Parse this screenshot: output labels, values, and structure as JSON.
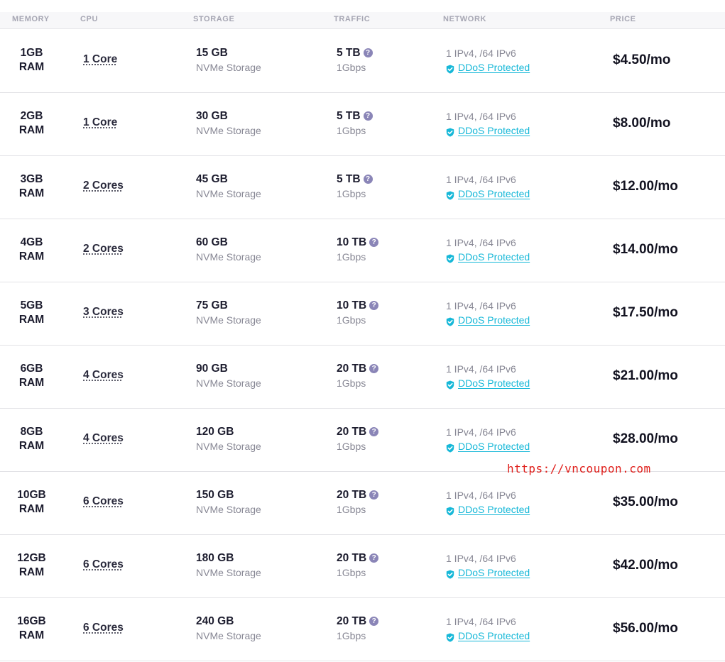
{
  "header": {
    "memory": "MEMORY",
    "cpu": "CPU",
    "storage": "STORAGE",
    "traffic": "TRAFFIC",
    "network": "NETWORK",
    "price": "PRICE"
  },
  "colors": {
    "accent_link": "#17b8d8",
    "help_icon": "#8a85b7",
    "watermark": "#e0201c"
  },
  "icons": {
    "help": "question-circle-icon",
    "ddos": "shield-check-icon"
  },
  "plans": [
    {
      "ram": "1GB",
      "ram_unit": "RAM",
      "cpu": "1 Core",
      "storage": "15 GB",
      "storage_type": "NVMe Storage",
      "traffic": "5 TB",
      "port": "1Gbps",
      "ips": "1 IPv4, /64 IPv6",
      "ddos": "DDoS Protected",
      "price": "$4.50/mo"
    },
    {
      "ram": "2GB",
      "ram_unit": "RAM",
      "cpu": "1 Core",
      "storage": "30 GB",
      "storage_type": "NVMe Storage",
      "traffic": "5 TB",
      "port": "1Gbps",
      "ips": "1 IPv4, /64 IPv6",
      "ddos": "DDoS Protected",
      "price": "$8.00/mo"
    },
    {
      "ram": "3GB",
      "ram_unit": "RAM",
      "cpu": "2 Cores",
      "storage": "45 GB",
      "storage_type": "NVMe Storage",
      "traffic": "5 TB",
      "port": "1Gbps",
      "ips": "1 IPv4, /64 IPv6",
      "ddos": "DDoS Protected",
      "price": "$12.00/mo"
    },
    {
      "ram": "4GB",
      "ram_unit": "RAM",
      "cpu": "2 Cores",
      "storage": "60 GB",
      "storage_type": "NVMe Storage",
      "traffic": "10 TB",
      "port": "1Gbps",
      "ips": "1 IPv4, /64 IPv6",
      "ddos": "DDoS Protected",
      "price": "$14.00/mo"
    },
    {
      "ram": "5GB",
      "ram_unit": "RAM",
      "cpu": "3 Cores",
      "storage": "75 GB",
      "storage_type": "NVMe Storage",
      "traffic": "10 TB",
      "port": "1Gbps",
      "ips": "1 IPv4, /64 IPv6",
      "ddos": "DDoS Protected",
      "price": "$17.50/mo"
    },
    {
      "ram": "6GB",
      "ram_unit": "RAM",
      "cpu": "4 Cores",
      "storage": "90 GB",
      "storage_type": "NVMe Storage",
      "traffic": "20 TB",
      "port": "1Gbps",
      "ips": "1 IPv4, /64 IPv6",
      "ddos": "DDoS Protected",
      "price": "$21.00/mo"
    },
    {
      "ram": "8GB",
      "ram_unit": "RAM",
      "cpu": "4 Cores",
      "storage": "120 GB",
      "storage_type": "NVMe Storage",
      "traffic": "20 TB",
      "port": "1Gbps",
      "ips": "1 IPv4, /64 IPv6",
      "ddos": "DDoS Protected",
      "price": "$28.00/mo"
    },
    {
      "ram": "10GB",
      "ram_unit": "RAM",
      "cpu": "6 Cores",
      "storage": "150 GB",
      "storage_type": "NVMe Storage",
      "traffic": "20 TB",
      "port": "1Gbps",
      "ips": "1 IPv4, /64 IPv6",
      "ddos": "DDoS Protected",
      "price": "$35.00/mo"
    },
    {
      "ram": "12GB",
      "ram_unit": "RAM",
      "cpu": "6 Cores",
      "storage": "180 GB",
      "storage_type": "NVMe Storage",
      "traffic": "20 TB",
      "port": "1Gbps",
      "ips": "1 IPv4, /64 IPv6",
      "ddos": "DDoS Protected",
      "price": "$42.00/mo"
    },
    {
      "ram": "16GB",
      "ram_unit": "RAM",
      "cpu": "6 Cores",
      "storage": "240 GB",
      "storage_type": "NVMe Storage",
      "traffic": "20 TB",
      "port": "1Gbps",
      "ips": "1 IPv4, /64 IPv6",
      "ddos": "DDoS Protected",
      "price": "$56.00/mo"
    }
  ],
  "watermark": "https://vncoupon.com"
}
